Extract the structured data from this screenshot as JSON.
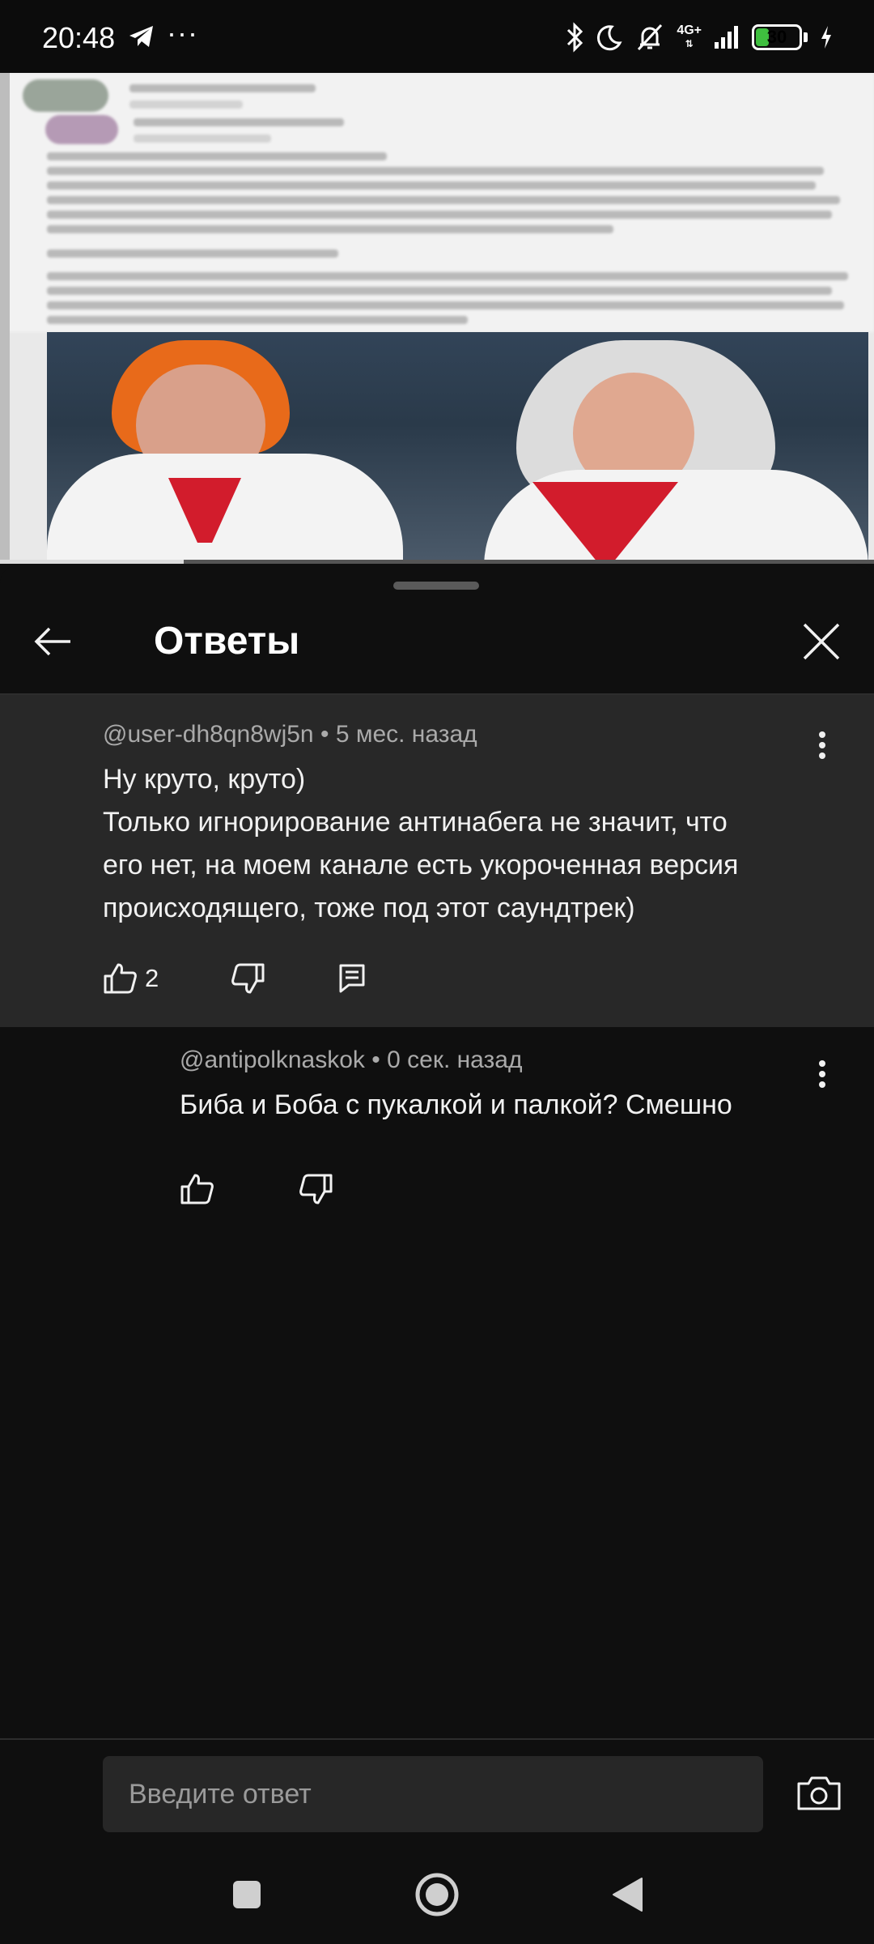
{
  "status_bar": {
    "time": "20:48",
    "more": "···",
    "network": "4G+",
    "battery": "30",
    "battery_level_percent": 30,
    "icons": [
      "telegram-icon",
      "bluetooth-icon",
      "moon-icon",
      "bell-off-icon",
      "signal-icon",
      "charging-icon"
    ]
  },
  "video": {
    "progress_fraction": 0.21
  },
  "sheet": {
    "title": "Ответы"
  },
  "parent_comment": {
    "author": "@user-dh8qn8wj5n",
    "time": "5 мес. назад",
    "lines": [
      "Ну круто, круто)",
      "Только игнорирование антинабега не значит, что",
      "его нет, на моем канале есть укороченная версия",
      "происходящего, тоже под этот саундтрек)"
    ],
    "likes": "2"
  },
  "reply": {
    "author": "@antipolknaskok",
    "time": "0 сек. назад",
    "text": "Биба и Боба с пукалкой и палкой? Смешно"
  },
  "input": {
    "placeholder": "Введите ответ"
  },
  "colors": {
    "background": "#0f0f0f",
    "highlight": "#282828",
    "meta": "#aaaaaa",
    "text": "#f1f1f1",
    "battery": "#3fbf3f"
  }
}
